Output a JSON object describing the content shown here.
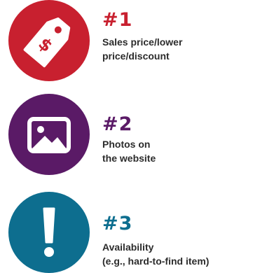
{
  "items": [
    {
      "rank": "#1",
      "lines": [
        "Sales price/lower",
        "price/discount"
      ],
      "icon": "price-tag-icon",
      "color": "#c8202f"
    },
    {
      "rank": "#2",
      "lines": [
        "Photos on",
        "the website"
      ],
      "icon": "image-icon",
      "color": "#5a1a66"
    },
    {
      "rank": "#3",
      "lines": [
        "Availability",
        "(e.g., hard-to-find item)"
      ],
      "icon": "exclamation-icon",
      "color": "#0d6e8f"
    }
  ],
  "icons": {
    "tag_symbol": "$"
  }
}
